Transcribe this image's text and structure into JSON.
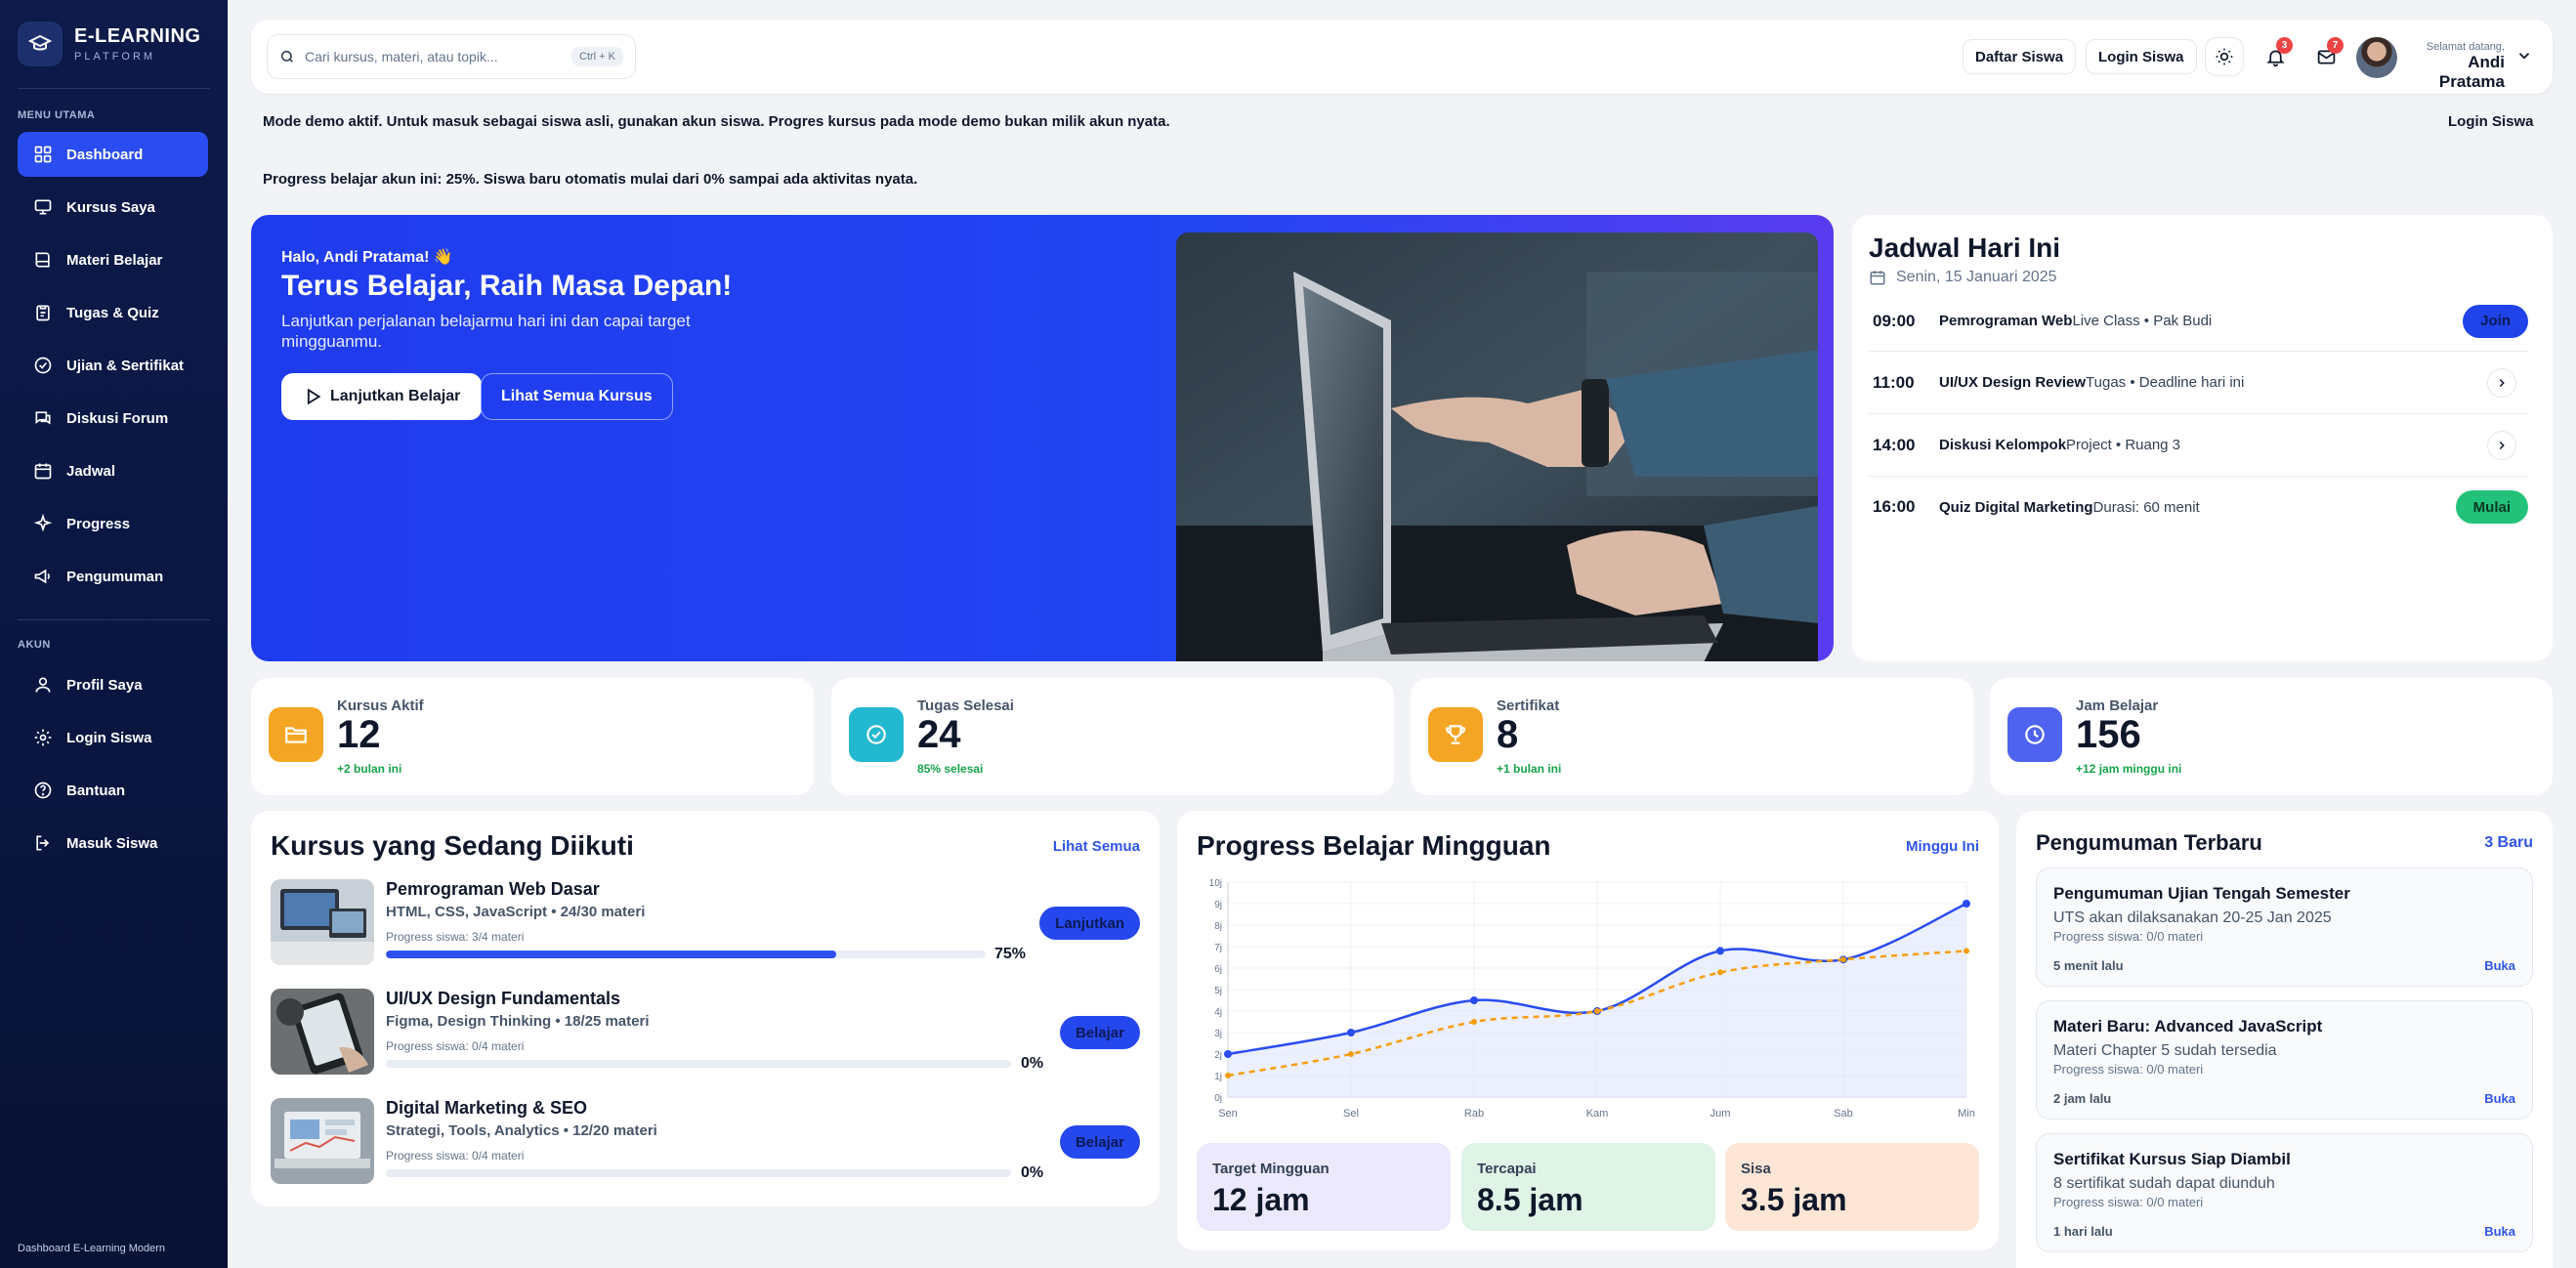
{
  "brand": {
    "title": "E-LEARNING",
    "subtitle": "PLATFORM"
  },
  "sidebar": {
    "section_main": "MENU UTAMA",
    "section_account": "AKUN",
    "items": [
      {
        "label": "Dashboard",
        "icon": "grid-icon"
      },
      {
        "label": "Kursus Saya",
        "icon": "monitor-icon"
      },
      {
        "label": "Materi Belajar",
        "icon": "book-icon"
      },
      {
        "label": "Tugas & Quiz",
        "icon": "clipboard-icon"
      },
      {
        "label": "Ujian & Sertifikat",
        "icon": "check-circle-icon"
      },
      {
        "label": "Diskusi Forum",
        "icon": "chat-icon"
      },
      {
        "label": "Jadwal",
        "icon": "calendar-icon"
      },
      {
        "label": "Progress",
        "icon": "sparkle-icon"
      },
      {
        "label": "Pengumuman",
        "icon": "megaphone-icon"
      }
    ],
    "account_items": [
      {
        "label": "Profil Saya",
        "icon": "user-icon"
      },
      {
        "label": "Login Siswa",
        "icon": "gear-icon"
      },
      {
        "label": "Bantuan",
        "icon": "help-icon"
      },
      {
        "label": "Masuk Siswa",
        "icon": "login-icon"
      }
    ],
    "footer": "Dashboard E-Learning Modern"
  },
  "topbar": {
    "search_placeholder": "Cari kursus, materi, atau topik...",
    "shortcut": "Ctrl + K",
    "register_label": "Daftar Siswa",
    "login_label": "Login Siswa",
    "notif_count": "3",
    "mail_count": "7",
    "welcome": "Selamat datang,",
    "user_name": "Andi Pratama"
  },
  "notices": {
    "demo": "Mode demo aktif. Untuk masuk sebagai siswa asli, gunakan akun siswa. Progres kursus pada mode demo bukan milik akun nyata.",
    "demo_login": "Login Siswa",
    "progress": "Progress belajar akun ini: 25%. Siswa baru otomatis mulai dari 0% sampai ada aktivitas nyata."
  },
  "hero": {
    "hello": "Halo, Andi Pratama! 👋",
    "title": "Terus Belajar, Raih Masa Depan!",
    "subtitle": "Lanjutkan perjalanan belajarmu hari ini dan capai target mingguanmu.",
    "primary_btn": "Lanjutkan Belajar",
    "secondary_btn": "Lihat Semua Kursus"
  },
  "schedule": {
    "title": "Jadwal Hari Ini",
    "date": "Senin, 15 Januari 2025",
    "rows": [
      {
        "time": "09:00",
        "name": "Pemrograman Web",
        "meta": "Live Class • Pak Budi",
        "action": "Join"
      },
      {
        "time": "11:00",
        "name": "UI/UX Design Review",
        "meta": "Tugas • Deadline hari ini",
        "action": ""
      },
      {
        "time": "14:00",
        "name": "Diskusi Kelompok",
        "meta": "Project • Ruang 3",
        "action": ""
      },
      {
        "time": "16:00",
        "name": "Quiz Digital Marketing",
        "meta": "Durasi: 60 menit",
        "action": "Mulai"
      }
    ]
  },
  "stats": [
    {
      "label": "Kursus Aktif",
      "value": "12",
      "delta": "+2 bulan ini",
      "color": "#f5a524",
      "icon": "folder-icon"
    },
    {
      "label": "Tugas Selesai",
      "value": "24",
      "delta": "85% selesai",
      "color": "#22b8cf",
      "icon": "check-badge-icon"
    },
    {
      "label": "Sertifikat",
      "value": "8",
      "delta": "+1 bulan ini",
      "color": "#f5a524",
      "icon": "trophy-icon"
    },
    {
      "label": "Jam Belajar",
      "value": "156",
      "delta": "+12 jam minggu ini",
      "color": "#4f63f0",
      "icon": "clock-icon"
    }
  ],
  "courses": {
    "title": "Kursus yang Sedang Diikuti",
    "link": "Lihat Semua",
    "items": [
      {
        "title": "Pemrograman Web Dasar",
        "meta": "HTML, CSS, JavaScript • 24/30 materi",
        "progress_text": "Progress siswa: 3/4 materi",
        "progress": 75,
        "pct": "75%",
        "button": "Lanjutkan"
      },
      {
        "title": "UI/UX Design Fundamentals",
        "meta": "Figma, Design Thinking • 18/25 materi",
        "progress_text": "Progress siswa: 0/4 materi",
        "progress": 0,
        "pct": "0%",
        "button": "Belajar"
      },
      {
        "title": "Digital Marketing & SEO",
        "meta": "Strategi, Tools, Analytics • 12/20 materi",
        "progress_text": "Progress siswa: 0/4 materi",
        "progress": 0,
        "pct": "0%",
        "button": "Belajar"
      }
    ]
  },
  "weekly": {
    "title": "Progress Belajar Mingguan",
    "period": "Minggu Ini",
    "target_label": "Target Mingguan",
    "target_value": "12 jam",
    "done_label": "Tercapai",
    "done_value": "8.5 jam",
    "rest_label": "Sisa",
    "rest_value": "3.5 jam"
  },
  "chart_data": {
    "type": "line",
    "categories": [
      "Sen",
      "Sel",
      "Rab",
      "Kam",
      "Jum",
      "Sab",
      "Min"
    ],
    "yticks": [
      "0j",
      "1j",
      "2j",
      "3j",
      "4j",
      "5j",
      "6j",
      "7j",
      "8j",
      "9j",
      "10j"
    ],
    "ylim": [
      0,
      10
    ],
    "grid": true,
    "series": [
      {
        "values": [
          2,
          3,
          4.5,
          4,
          6.8,
          6.4,
          9
        ],
        "color": "#2a4cf0",
        "style": "solid-area"
      },
      {
        "values": [
          1,
          2,
          3.5,
          4,
          5.8,
          6.4,
          6.8
        ],
        "color": "#f59e0b",
        "style": "dashed"
      }
    ]
  },
  "announcements": {
    "title": "Pengumuman Terbaru",
    "count": "3 Baru",
    "open": "Buka",
    "items": [
      {
        "title": "Pengumuman Ujian Tengah Semester",
        "desc": "UTS akan dilaksanakan 20-25 Jan 2025",
        "progress": "Progress siswa: 0/0 materi",
        "time": "5 menit lalu"
      },
      {
        "title": "Materi Baru: Advanced JavaScript",
        "desc": "Materi Chapter 5 sudah tersedia",
        "progress": "Progress siswa: 0/0 materi",
        "time": "2 jam lalu"
      },
      {
        "title": "Sertifikat Kursus Siap Diambil",
        "desc": "8 sertifikat sudah dapat diunduh",
        "progress": "Progress siswa: 0/0 materi",
        "time": "1 hari lalu"
      }
    ]
  }
}
